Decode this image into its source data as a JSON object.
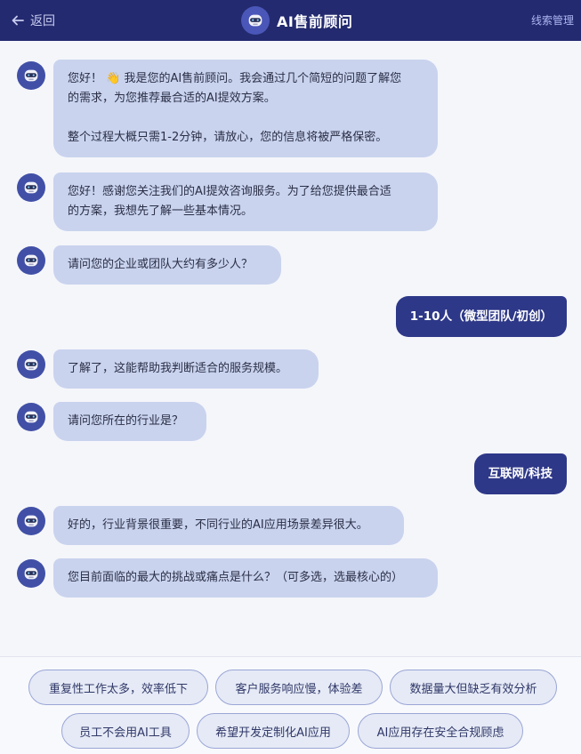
{
  "header": {
    "back_label": "返回",
    "title": "AI售前顾问",
    "leads_label": "线索管理"
  },
  "messages": [
    {
      "role": "ai",
      "lines": [
        "您好！ 👋 我是您的AI售前顾问。我会通过几个简短的问题了解您",
        "的需求，为您推荐最合适的AI提效方案。",
        "",
        "整个过程大概只需1-2分钟，请放心，您的信息将被严格保密。"
      ]
    },
    {
      "role": "ai",
      "lines": [
        "您好！感谢您关注我们的AI提效咨询服务。为了给您提供最合适",
        "的方案，我想先了解一些基本情况。"
      ]
    },
    {
      "role": "ai",
      "lines": [
        "请问您的企业或团队大约有多少人？"
      ]
    },
    {
      "role": "user",
      "text": "1-10人（微型团队/初创）"
    },
    {
      "role": "ai",
      "lines": [
        "了解了，这能帮助我判断适合的服务规模。"
      ]
    },
    {
      "role": "ai",
      "lines": [
        "请问您所在的行业是？"
      ]
    },
    {
      "role": "user",
      "text": "互联网/科技"
    },
    {
      "role": "ai",
      "lines": [
        "好的，行业背景很重要，不同行业的AI应用场景差异很大。"
      ]
    },
    {
      "role": "ai",
      "lines": [
        "您目前面临的最大的挑战或痛点是什么？（可多选，选最核心的）"
      ]
    }
  ],
  "options": [
    "重复性工作太多，效率低下",
    "客户服务响应慢，体验差",
    "数据量大但缺乏有效分析",
    "员工不会用AI工具",
    "希望开发定制化AI应用",
    "AI应用存在安全合规顾虑"
  ],
  "colors": {
    "header_bg": "#232a6f",
    "ai_bubble": "#c9d3ee",
    "user_bubble": "#2e3888",
    "avatar": "#4150a6"
  },
  "icons": {
    "back": "arrow-left-icon",
    "avatar": "robot-icon"
  }
}
